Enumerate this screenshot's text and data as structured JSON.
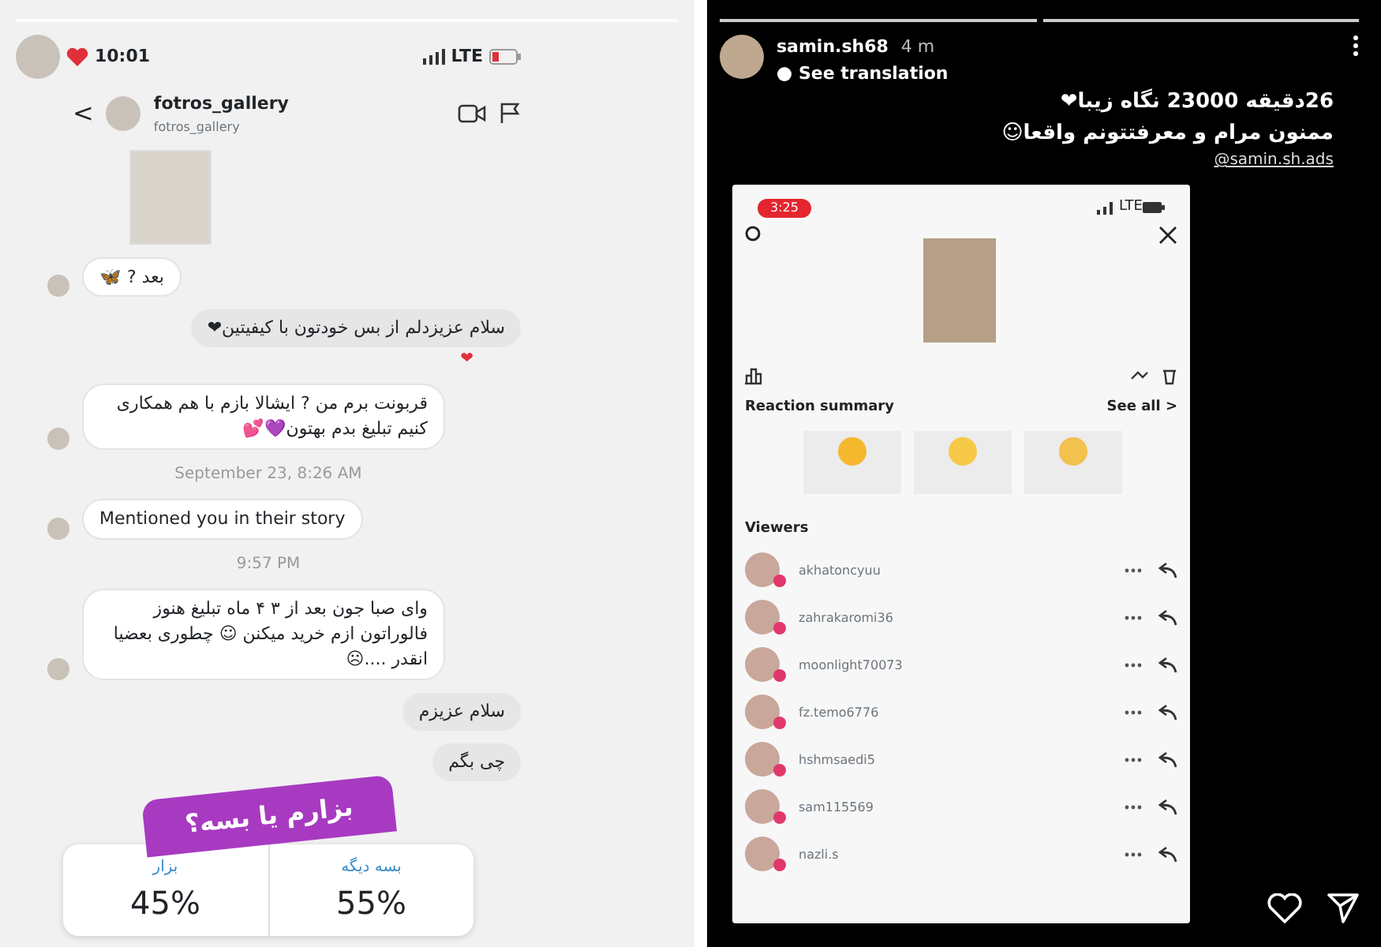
{
  "chat_story": {
    "status_bar": {
      "time": "10:01",
      "network": "LTE"
    },
    "header": {
      "back": "<",
      "username": "fotros_gallery",
      "subtitle": "fotros_gallery"
    },
    "messages": [
      {
        "kind": "received",
        "text": "بعد ? 🦋"
      },
      {
        "kind": "sent",
        "text": "سلام عزیزدلم  از بس خودتون با کیفیتین❤",
        "reaction": "❤"
      },
      {
        "kind": "received",
        "text": "قربونت برم من ? ایشالا بازم با هم همکاری کنیم تبلیغ بدم بهتون💜💕"
      },
      {
        "kind": "timestamp",
        "text": "September 23, 8:26 AM"
      },
      {
        "kind": "received",
        "text": "Mentioned you in their story"
      },
      {
        "kind": "timestamp",
        "text": "9:57 PM"
      },
      {
        "kind": "received",
        "text": "وای صبا جون بعد از ۳ ۴ ماه تبلیغ هنوز فالوراتون ازم خرید میکنن ☺ چطوری بعضیا انقدر ....☹"
      },
      {
        "kind": "sent",
        "text": "سلام عزیزم"
      },
      {
        "kind": "sent",
        "text": "چی بگم"
      }
    ],
    "poll": {
      "question": "بزارم یا بسه؟",
      "options": [
        {
          "label": "بسه دیگه",
          "percent": "55%"
        },
        {
          "label": "بزار",
          "percent": "45%"
        }
      ]
    }
  },
  "viewer_story": {
    "username": "samin.sh68",
    "age": "4 m",
    "translation": "See translation",
    "caption": [
      "26دقیقه 23000 نگاه زیبا❤",
      "ممنون مرام و معرفتتونم واقعا☺"
    ],
    "mention": "@samin.sh.ads",
    "screenshot": {
      "time": "3:25",
      "network": "LTE",
      "reaction_title": "Reaction summary",
      "see_all": "See all >",
      "reactions": [
        {
          "color": "#f5b82e"
        },
        {
          "color": "#f7c948"
        },
        {
          "color": "#f2c14e"
        }
      ],
      "viewers_title": "Viewers",
      "viewers": [
        {
          "name": "akhatoncyuu"
        },
        {
          "name": "zahrakaromi36"
        },
        {
          "name": "moonlight70073"
        },
        {
          "name": "fz.temo6776"
        },
        {
          "name": "hshmsaedi5"
        },
        {
          "name": "sam115569"
        },
        {
          "name": "nazli.s"
        }
      ]
    }
  }
}
